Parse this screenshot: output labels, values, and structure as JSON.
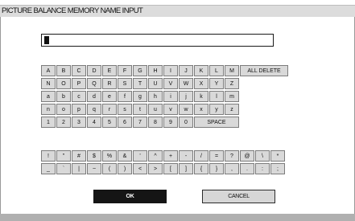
{
  "title": "PICTURE BALANCE MEMORY NAME INPUT",
  "input": {
    "value": ""
  },
  "keyboard_rows": [
    [
      "A",
      "B",
      "C",
      "D",
      "E",
      "F",
      "G",
      "H",
      "I",
      "J",
      "K",
      "L",
      "M"
    ],
    [
      "N",
      "O",
      "P",
      "Q",
      "R",
      "S",
      "T",
      "U",
      "V",
      "W",
      "X",
      "Y",
      "Z"
    ],
    [
      "a",
      "b",
      "c",
      "d",
      "e",
      "f",
      "g",
      "h",
      "i",
      "j",
      "k",
      "l",
      "m"
    ],
    [
      "n",
      "o",
      "p",
      "q",
      "r",
      "s",
      "t",
      "u",
      "v",
      "w",
      "x",
      "y",
      "z"
    ],
    [
      "1",
      "2",
      "3",
      "4",
      "5",
      "6",
      "7",
      "8",
      "9",
      "0"
    ]
  ],
  "all_delete_label": "ALL DELETE",
  "space_label": "SPACE",
  "symbols": [
    [
      "!",
      "_"
    ],
    [
      "\"",
      "`"
    ],
    [
      "#",
      "|"
    ],
    [
      "$",
      "~"
    ],
    [
      "%",
      "("
    ],
    [
      "&",
      ")"
    ],
    [
      "'",
      "<"
    ],
    [
      "^",
      ">"
    ],
    [
      "+",
      "["
    ],
    [
      "-",
      "]"
    ],
    [
      "/",
      "{"
    ],
    [
      "=",
      "}"
    ],
    [
      "?",
      ","
    ],
    [
      "@",
      "."
    ],
    [
      "\\",
      ":"
    ],
    [
      "*",
      ";"
    ]
  ],
  "buttons": {
    "ok": "OK",
    "cancel": "CANCEL"
  }
}
